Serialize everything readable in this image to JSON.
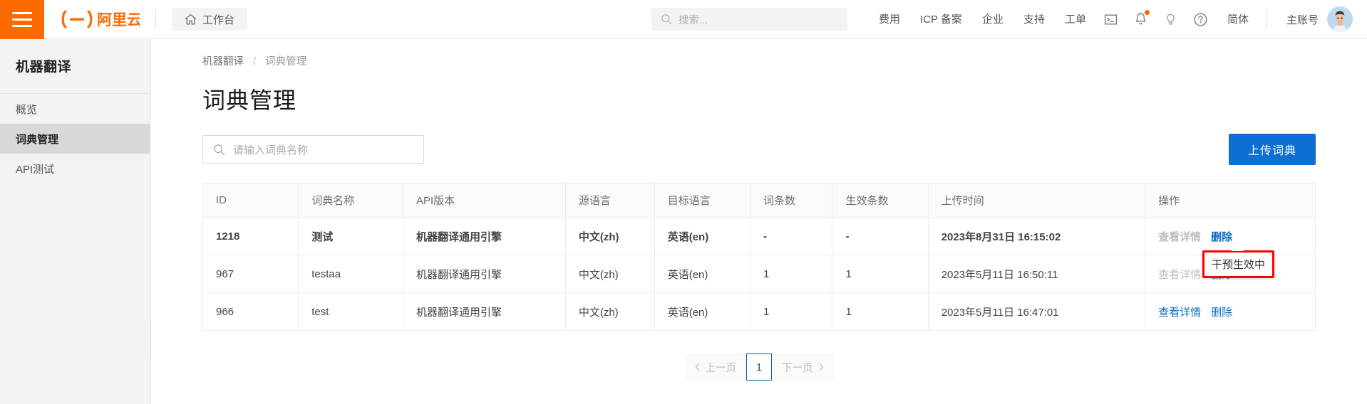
{
  "topbar": {
    "hamburger_icon": "hamburger-menu-icon",
    "logo_text": "阿里云",
    "workbench": {
      "label": "工作台",
      "icon": "home-icon"
    },
    "search": {
      "placeholder": "搜索...",
      "icon": "search-icon",
      "value": ""
    },
    "nav_links": [
      "费用",
      "ICP 备案",
      "企业",
      "支持",
      "工单"
    ],
    "icons": [
      {
        "name": "terminal-icon",
        "badge": false
      },
      {
        "name": "bell-icon",
        "badge": true
      },
      {
        "name": "lightbulb-icon",
        "badge": false
      },
      {
        "name": "question-circle-icon",
        "badge": false
      }
    ],
    "language": "简体",
    "account_name": "主账号",
    "accent_orange": "#ff6a00"
  },
  "sidebar": {
    "title": "机器翻译",
    "items": [
      {
        "label": "概览",
        "active": false
      },
      {
        "label": "词典管理",
        "active": true
      },
      {
        "label": "API测试",
        "active": false
      }
    ],
    "collapse_icon": "chevron-left-icon"
  },
  "main": {
    "breadcrumb": {
      "parent": "机器翻译",
      "separator": "/",
      "current": "词典管理"
    },
    "page_title": "词典管理",
    "toolbar": {
      "search_placeholder": "请输入词典名称",
      "search_value": "",
      "search_icon": "search-icon",
      "upload_label": "上传词典",
      "upload_color": "#0c6fd1"
    },
    "table": {
      "columns": [
        "ID",
        "词典名称",
        "API版本",
        "源语言",
        "目标语言",
        "词条数",
        "生效条数",
        "上传时间",
        "操作"
      ],
      "rows": [
        {
          "id": "1218",
          "name": "测试",
          "api_version": "机器翻译通用引擎",
          "source_lang": "中文(zh)",
          "target_lang": "英语(en)",
          "entry_count": "-",
          "effective_count": "-",
          "upload_time": "2023年8月31日 16:15:02",
          "actions": [
            {
              "label": "查看详情",
              "disabled": true
            },
            {
              "label": "删除",
              "disabled": false
            }
          ]
        },
        {
          "id": "967",
          "name": "testaa",
          "api_version": "机器翻译通用引擎",
          "source_lang": "中文(zh)",
          "target_lang": "英语(en)",
          "entry_count": "1",
          "effective_count": "1",
          "upload_time": "2023年5月11日 16:50:11",
          "actions": [
            {
              "label": "查看详情",
              "disabled": true
            },
            {
              "label": "删除",
              "disabled": false
            }
          ]
        },
        {
          "id": "966",
          "name": "test",
          "api_version": "机器翻译通用引擎",
          "source_lang": "中文(zh)",
          "target_lang": "英语(en)",
          "entry_count": "1",
          "effective_count": "1",
          "upload_time": "2023年5月11日 16:47:01",
          "actions": [
            {
              "label": "查看详情",
              "disabled": false
            },
            {
              "label": "删除",
              "disabled": false
            }
          ]
        }
      ]
    },
    "tooltip": {
      "text": "干预生效中",
      "border_color": "#ff0000"
    },
    "pagination": {
      "prev_label": "上一页",
      "next_label": "下一页",
      "current_page": "1",
      "prev_icon": "chevron-left-icon",
      "next_icon": "chevron-right-icon"
    }
  }
}
